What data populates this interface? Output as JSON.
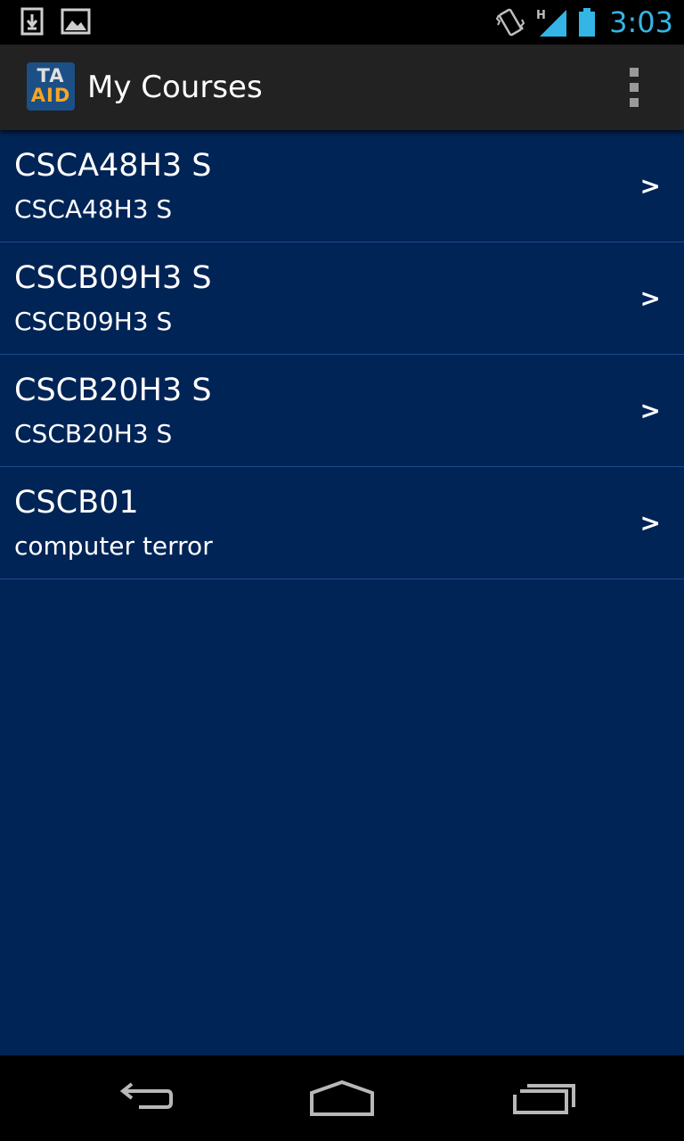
{
  "status_bar": {
    "left_icons": [
      "download-icon",
      "image-icon"
    ],
    "right_icons": [
      "vibrate-icon",
      "signal-h-icon",
      "battery-icon"
    ],
    "network_type": "H",
    "time": "3:03",
    "time_color": "#33b5e5"
  },
  "action_bar": {
    "logo_line1": "TA",
    "logo_line2": "AID",
    "title": "My Courses",
    "overflow_icon": "overflow-menu-icon"
  },
  "courses": [
    {
      "code": "CSCA48H3 S",
      "name": "CSCA48H3 S",
      "chevron": ">"
    },
    {
      "code": "CSCB09H3 S",
      "name": "CSCB09H3 S",
      "chevron": ">"
    },
    {
      "code": "CSCB20H3 S",
      "name": "CSCB20H3 S",
      "chevron": ">"
    },
    {
      "code": "CSCB01",
      "name": "computer terror",
      "chevron": ">"
    }
  ],
  "nav_bar": {
    "buttons": [
      "back-icon",
      "home-icon",
      "recents-icon"
    ]
  },
  "colors": {
    "list_background": "#012456",
    "action_bar": "#222222",
    "divider": "#1b4b8c"
  }
}
